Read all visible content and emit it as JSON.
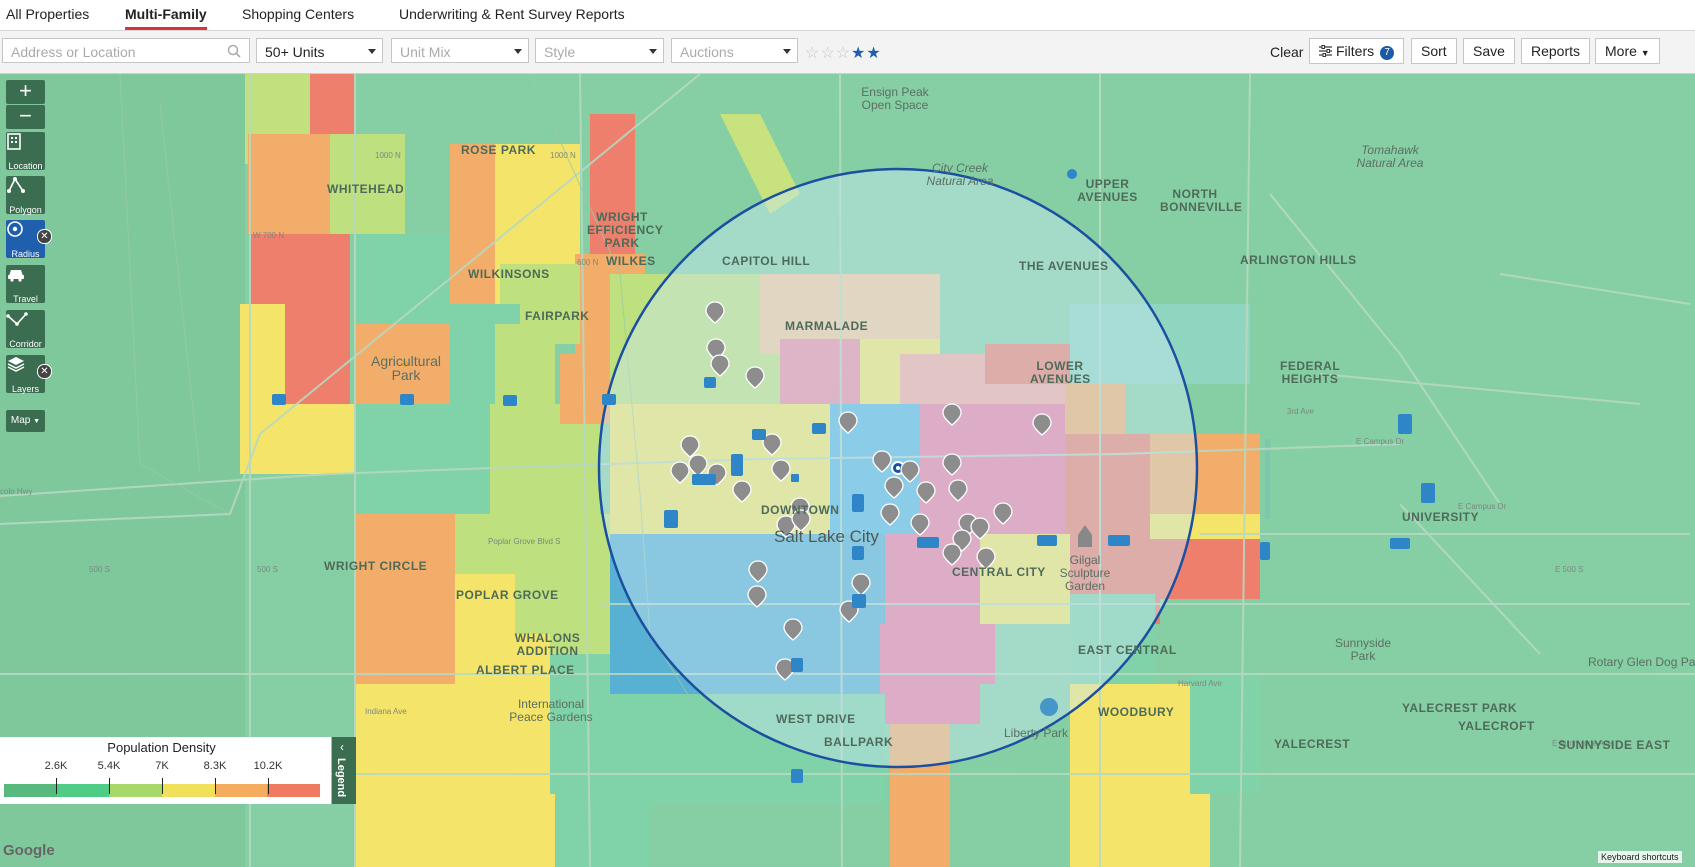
{
  "tabs": [
    {
      "label": "All Properties",
      "active": false
    },
    {
      "label": "Multi-Family",
      "active": true
    },
    {
      "label": "Shopping Centers",
      "active": false
    },
    {
      "label": "Underwriting & Rent Survey Reports",
      "active": false
    }
  ],
  "toolbar": {
    "location_placeholder": "Address or Location",
    "units_value": "50+ Units",
    "unit_mix_placeholder": "Unit Mix",
    "style_placeholder": "Style",
    "auctions_placeholder": "Auctions",
    "star_rating": {
      "empty": 3,
      "filled": 2
    },
    "clear_label": "Clear",
    "filters_label": "Filters",
    "filters_count": "7",
    "sort_label": "Sort",
    "save_label": "Save",
    "reports_label": "Reports",
    "more_label": "More"
  },
  "map_tools": {
    "zoom_in": "+",
    "zoom_out": "−",
    "location": "Location",
    "polygon": "Polygon",
    "radius": "Radius",
    "travel": "Travel",
    "corridor": "Corridor",
    "layers": "Layers",
    "map_type": "Map"
  },
  "legend": {
    "title": "Population Density",
    "tab_label": "Legend",
    "ticks": [
      "2.6K",
      "5.4K",
      "7K",
      "8.3K",
      "10.2K"
    ],
    "colors": [
      "#58b97f",
      "#4fcc86",
      "#a6d96a",
      "#f1e05a",
      "#f5ac5e",
      "#ef7a62"
    ]
  },
  "map": {
    "attribution": "Google",
    "keyboard_shortcuts": "Keyboard shortcuts",
    "city_label": "Salt Lake City",
    "neighborhoods": {
      "rose_park": "ROSE PARK",
      "whitehead": "WHITEHEAD",
      "wright_efficiency_park": "WRIGHT EFFICIENCY PARK",
      "wilkes": "WILKES",
      "wilkinsons": "WILKINSONS",
      "fairpark": "FAIRPARK",
      "capitol_hill": "CAPITOL HILL",
      "marmalade": "MARMALADE",
      "upper_avenues": "UPPER AVENUES",
      "north_bonneville": "NORTH BONNEVILLE",
      "the_avenues": "THE AVENUES",
      "arlington_hills": "ARLINGTON HILLS",
      "lower_avenues": "LOWER AVENUES",
      "federal_heights": "FEDERAL HEIGHTS",
      "university": "UNIVERSITY",
      "downtown": "DOWNTOWN",
      "central_city": "CENTRAL CITY",
      "wright_circle": "WRIGHT CIRCLE",
      "poplar_grove": "POPLAR GROVE",
      "whalons_addition": "WHALONS ADDITION",
      "albert_place": "ALBERT PLACE",
      "west_drive": "WEST DRIVE",
      "ballpark": "BALLPARK",
      "east_central": "EAST CENTRAL",
      "woodbury": "WOODBURY",
      "yalecrest_park": "YALECREST PARK",
      "yalecroft": "YALECROFT",
      "yalecrest": "YALECREST",
      "sunnyside_east": "SUNNYSIDE EAST"
    },
    "places": {
      "ensign_peak": "Ensign Peak Open Space",
      "city_creek": "City Creek Natural Area",
      "tomahawk": "Tomahawk Natural Area",
      "agricultural_park": "Agricultural Park",
      "gilgal": "Gilgal Sculpture Garden",
      "international_peace_gardens": "International Peace Gardens",
      "liberty_park": "Liberty Park",
      "sunnyside_park": "Sunnyside Park",
      "rotary_glen": "Rotary Glen Dog Park"
    }
  }
}
